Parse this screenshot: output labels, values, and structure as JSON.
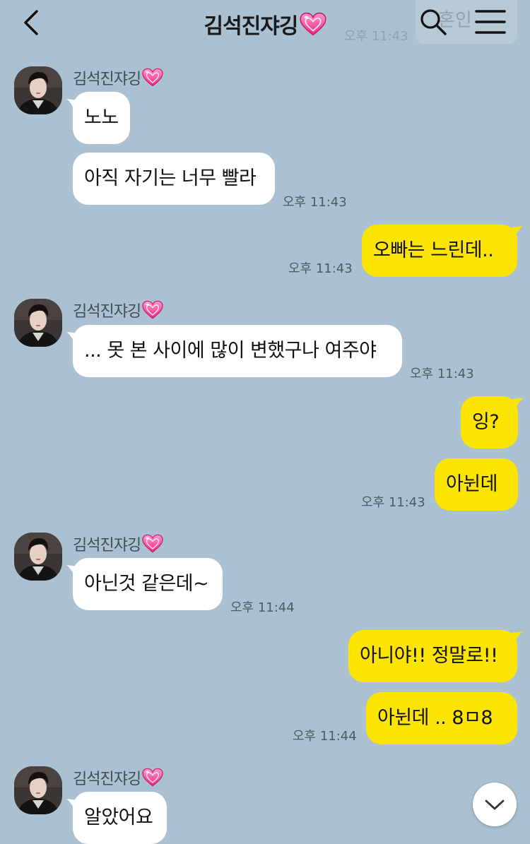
{
  "header": {
    "title": "김석진쟈깅",
    "ghost_text": "혼인",
    "ghost_time": "오후 11:43"
  },
  "messages": [
    {
      "sender": "김석진쟈깅",
      "text": "노노"
    },
    {
      "text": "아직 자기는 너무 빨라",
      "time": "오후 11:43"
    },
    {
      "text": "오빠는 느린데..",
      "time": "오후 11:43"
    },
    {
      "sender": "김석진쟈깅",
      "text": "... 못 본 사이에 많이 변했구나 여주야",
      "time": "오후 11:43"
    },
    {
      "text": "잉?"
    },
    {
      "text": "아뉜데",
      "time": "오후 11:43"
    },
    {
      "sender": "김석진쟈깅",
      "text": "아닌것 같은데~",
      "time": "오후 11:44"
    },
    {
      "text": "아니야!! 정말로!!"
    },
    {
      "text": "아뉜데 .. 8ㅁ8",
      "time": "오후 11:44"
    },
    {
      "sender": "김석진쟈깅",
      "text": "알았어요"
    }
  ],
  "colors": {
    "background": "#abc1d1",
    "incoming_bubble": "#ffffff",
    "outgoing_bubble": "#fbe400",
    "heart": "#f0409a"
  },
  "icons": [
    "back-arrow-icon",
    "search-icon",
    "menu-icon",
    "heart-icon",
    "chevron-down-icon"
  ]
}
